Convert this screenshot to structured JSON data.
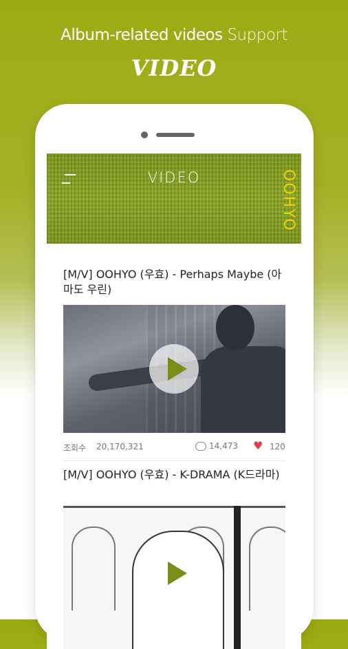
{
  "header": {
    "line1": "Album-related videos",
    "line1_light": "Support",
    "line2": "VIDEO"
  },
  "app": {
    "title": "VIDEO",
    "brand": "OOHYO",
    "icons": {
      "menu": "hamburger-menu-icon",
      "play": "play-icon",
      "comment": "comment-icon",
      "like": "heart-icon"
    },
    "colors": {
      "accent": "#8ea82c",
      "brand_yellow": "#f3d100",
      "heart": "#e23b4a",
      "play": "#7b8d17"
    }
  },
  "videos": [
    {
      "title": "[M/V] OOHYO (우효) - Perhaps Maybe (아마도 우린)",
      "views_label": "조회수",
      "views": "20,170,321",
      "comments": "14,473",
      "likes": "120"
    },
    {
      "title": "[M/V] OOHYO (우효) - K-DRAMA (K드라마)"
    }
  ]
}
